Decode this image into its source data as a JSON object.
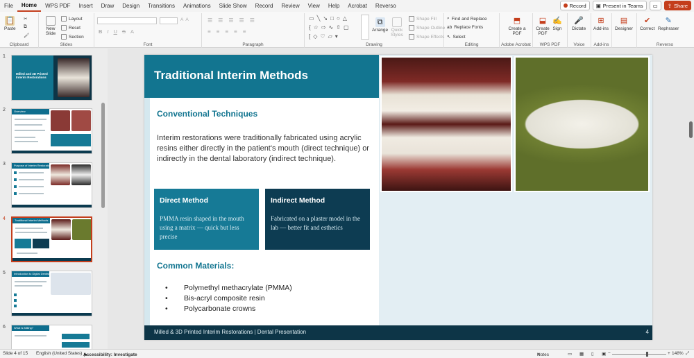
{
  "menu": [
    "File",
    "Home",
    "WPS PDF",
    "Insert",
    "Draw",
    "Design",
    "Transitions",
    "Animations",
    "Slide Show",
    "Record",
    "Review",
    "View",
    "Help",
    "Acrobat",
    "Reverso"
  ],
  "menu_right": {
    "record": "Record",
    "present": "Present in Teams",
    "share": "Share"
  },
  "ribbon": {
    "clipboard": {
      "name": "Clipboard",
      "paste": "Paste"
    },
    "slides": {
      "name": "Slides",
      "new_slide": "New Slide",
      "layout": "Layout",
      "reset": "Reset",
      "section": "Section"
    },
    "font": {
      "name": "Font"
    },
    "paragraph": {
      "name": "Paragraph"
    },
    "drawing": {
      "name": "Drawing",
      "arrange": "Arrange",
      "quick_styles": "Quick Styles",
      "shape_fill": "Shape Fill",
      "shape_outline": "Shape Outline",
      "shape_effects": "Shape Effects"
    },
    "editing": {
      "name": "Editing",
      "find_replace": "Find and Replace",
      "replace_fonts": "Replace Fonts",
      "select": "Select"
    },
    "adobe": {
      "name": "Adobe Acrobat",
      "create_pdf": "Create a PDF"
    },
    "wps": {
      "name": "WPS PDF",
      "create_pdf": "Create PDF",
      "sign": "Sign"
    },
    "voice": {
      "name": "Voice",
      "dictate": "Dictate"
    },
    "addins": {
      "name": "Add-ins",
      "addins": "Add-ins"
    },
    "designer": {
      "designer": "Designer"
    },
    "reverso": {
      "name": "Reverso",
      "correct": "Correct",
      "rephraser": "Rephraser"
    }
  },
  "thumbnails": [
    {
      "num": "1",
      "title": "Milled and 3D Printed Interim Restorations"
    },
    {
      "num": "2",
      "title": "Overview"
    },
    {
      "num": "3",
      "title": "Purpose of Interim Restorations"
    },
    {
      "num": "4",
      "title": "Traditional Interim Methods"
    },
    {
      "num": "5",
      "title": "Introduction to Digital Dentistry"
    },
    {
      "num": "6",
      "title": "What is Milling?"
    }
  ],
  "slide": {
    "title": "Traditional Interim Methods",
    "conventional_heading": "Conventional Techniques",
    "body": "Interim restorations were traditionally fabricated using acrylic resins either directly in the patient's mouth (direct technique) or indirectly in the dental laboratory (indirect technique).",
    "direct": {
      "title": "Direct Method",
      "text": "PMMA resin shaped in the mouth using a matrix — quick but less precise"
    },
    "indirect": {
      "title": "Indirect Method",
      "text": "Fabricated on a plaster model in the lab — better fit and esthetics"
    },
    "materials_heading": "Common Materials:",
    "materials": [
      "Polymethyl methacrylate (PMMA)",
      "Bis-acryl composite resin",
      "Polycarbonate crowns"
    ],
    "footer": "Milled & 3D Printed Interim Restorations  |  Dental Presentation",
    "page_number": "4"
  },
  "status": {
    "slide_of": "Slide 4 of 15",
    "language": "English (United States)",
    "accessibility": "Accessibility: Investigate",
    "notes": "Notes",
    "zoom": "148%"
  },
  "colors": {
    "accent": "#c43e1c",
    "teal": "#127590",
    "navy": "#0d3547"
  }
}
